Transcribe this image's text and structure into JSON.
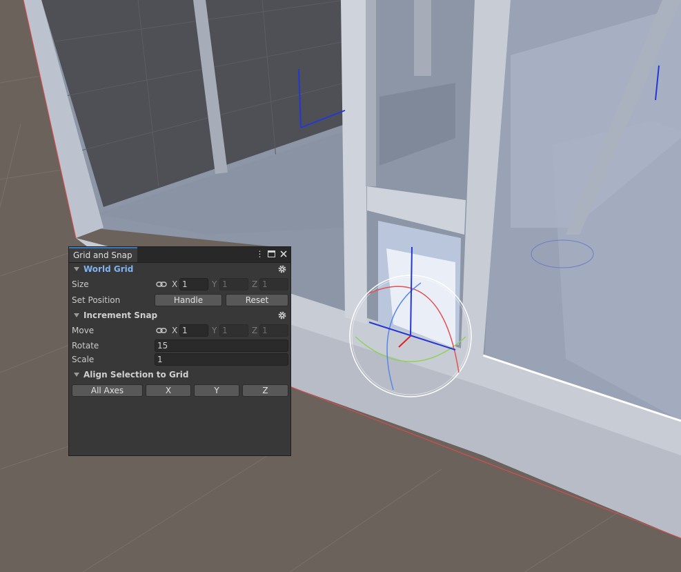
{
  "window": {
    "tab_title": "Grid and Snap",
    "actions": [
      "more-options-icon",
      "maximize-icon",
      "close-icon"
    ],
    "accent_color": "#3a79bb"
  },
  "world_grid": {
    "title": "World Grid",
    "size": {
      "label": "Size",
      "x_label": "X",
      "x_value": "1",
      "y_label": "Y",
      "y_value": "1",
      "z_label": "Z",
      "z_value": "1"
    },
    "set_position": {
      "label": "Set Position",
      "handle_button": "Handle",
      "reset_button": "Reset"
    }
  },
  "increment_snap": {
    "title": "Increment Snap",
    "move": {
      "label": "Move",
      "x_label": "X",
      "x_value": "1",
      "y_label": "Y",
      "y_value": "1",
      "z_label": "Z",
      "z_value": "1"
    },
    "rotate": {
      "label": "Rotate",
      "value": "15"
    },
    "scale": {
      "label": "Scale",
      "value": "1"
    }
  },
  "align": {
    "title": "Align Selection to Grid",
    "buttons": [
      "All Axes",
      "X",
      "Y",
      "Z"
    ]
  }
}
